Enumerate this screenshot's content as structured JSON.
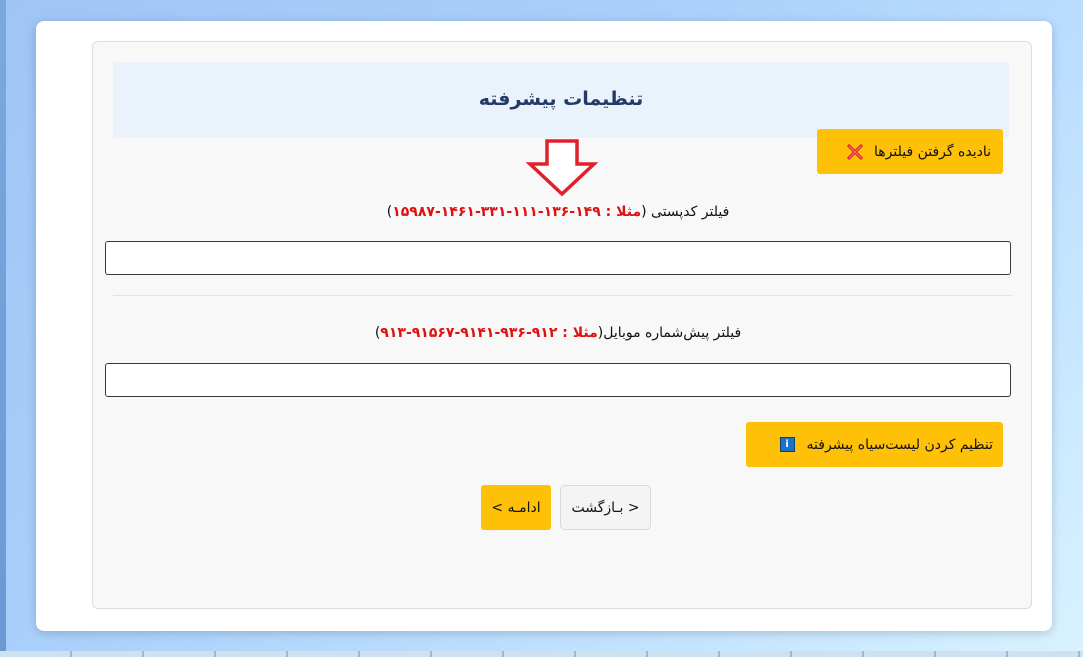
{
  "panel": {
    "title": "تنظیمات پیشرفته"
  },
  "ignore_filters_button": {
    "label": "نادیده گرفتن فیلترها",
    "icon": "close-x-icon",
    "icon_color": "#e0202a"
  },
  "postal_filter": {
    "label": "فیلتر کدپستی (",
    "example": "مثلا : ۱۴۹-۱۳۶-۱۱۱-۳۳۱-۱۴۶۱-۱۵۹۸۷",
    "label_end": ")",
    "value": "",
    "placeholder": ""
  },
  "mobile_filter": {
    "label": "فیلتر پیش‌شماره موبایل(",
    "example": "مثلا : ۹۱۲-۹۳۶-۹۱۴۱-۹۱۵۶۷-۹۱۳",
    "label_end": ")",
    "value": "",
    "placeholder": ""
  },
  "blacklist_button": {
    "label": "تنظیم کردن لیست‌سیاه پیشرفته",
    "icon": "info-icon",
    "icon_glyph": "i"
  },
  "nav": {
    "back_label": "< بـازگشت",
    "next_label": "ادامـه >"
  },
  "colors": {
    "accent": "#ffc107",
    "example_text": "#e01010",
    "title_text": "#233a66",
    "arrow": "#e0202a"
  }
}
